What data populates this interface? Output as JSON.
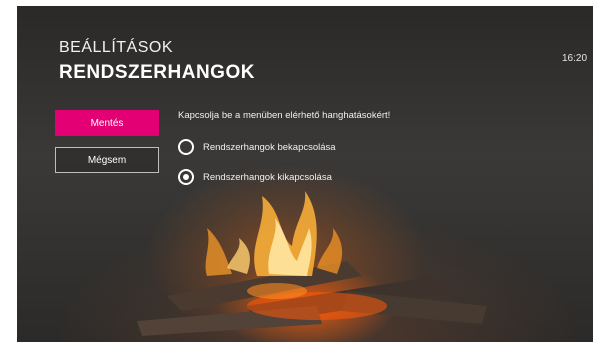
{
  "header": {
    "section": "BEÁLLÍTÁSOK",
    "title": "RENDSZERHANGOK",
    "clock": "16:20"
  },
  "actions": {
    "save_label": "Mentés",
    "cancel_label": "Mégsem"
  },
  "settings": {
    "instruction": "Kapcsolja be a menüben elérhető hanghatásokért!",
    "options": [
      {
        "label": "Rendszerhangok bekapcsolása",
        "selected": false
      },
      {
        "label": "Rendszerhangok kikapcsolása",
        "selected": true
      }
    ]
  },
  "colors": {
    "accent": "#e20074",
    "background": "#2f2d2b",
    "text": "#ffffff"
  }
}
